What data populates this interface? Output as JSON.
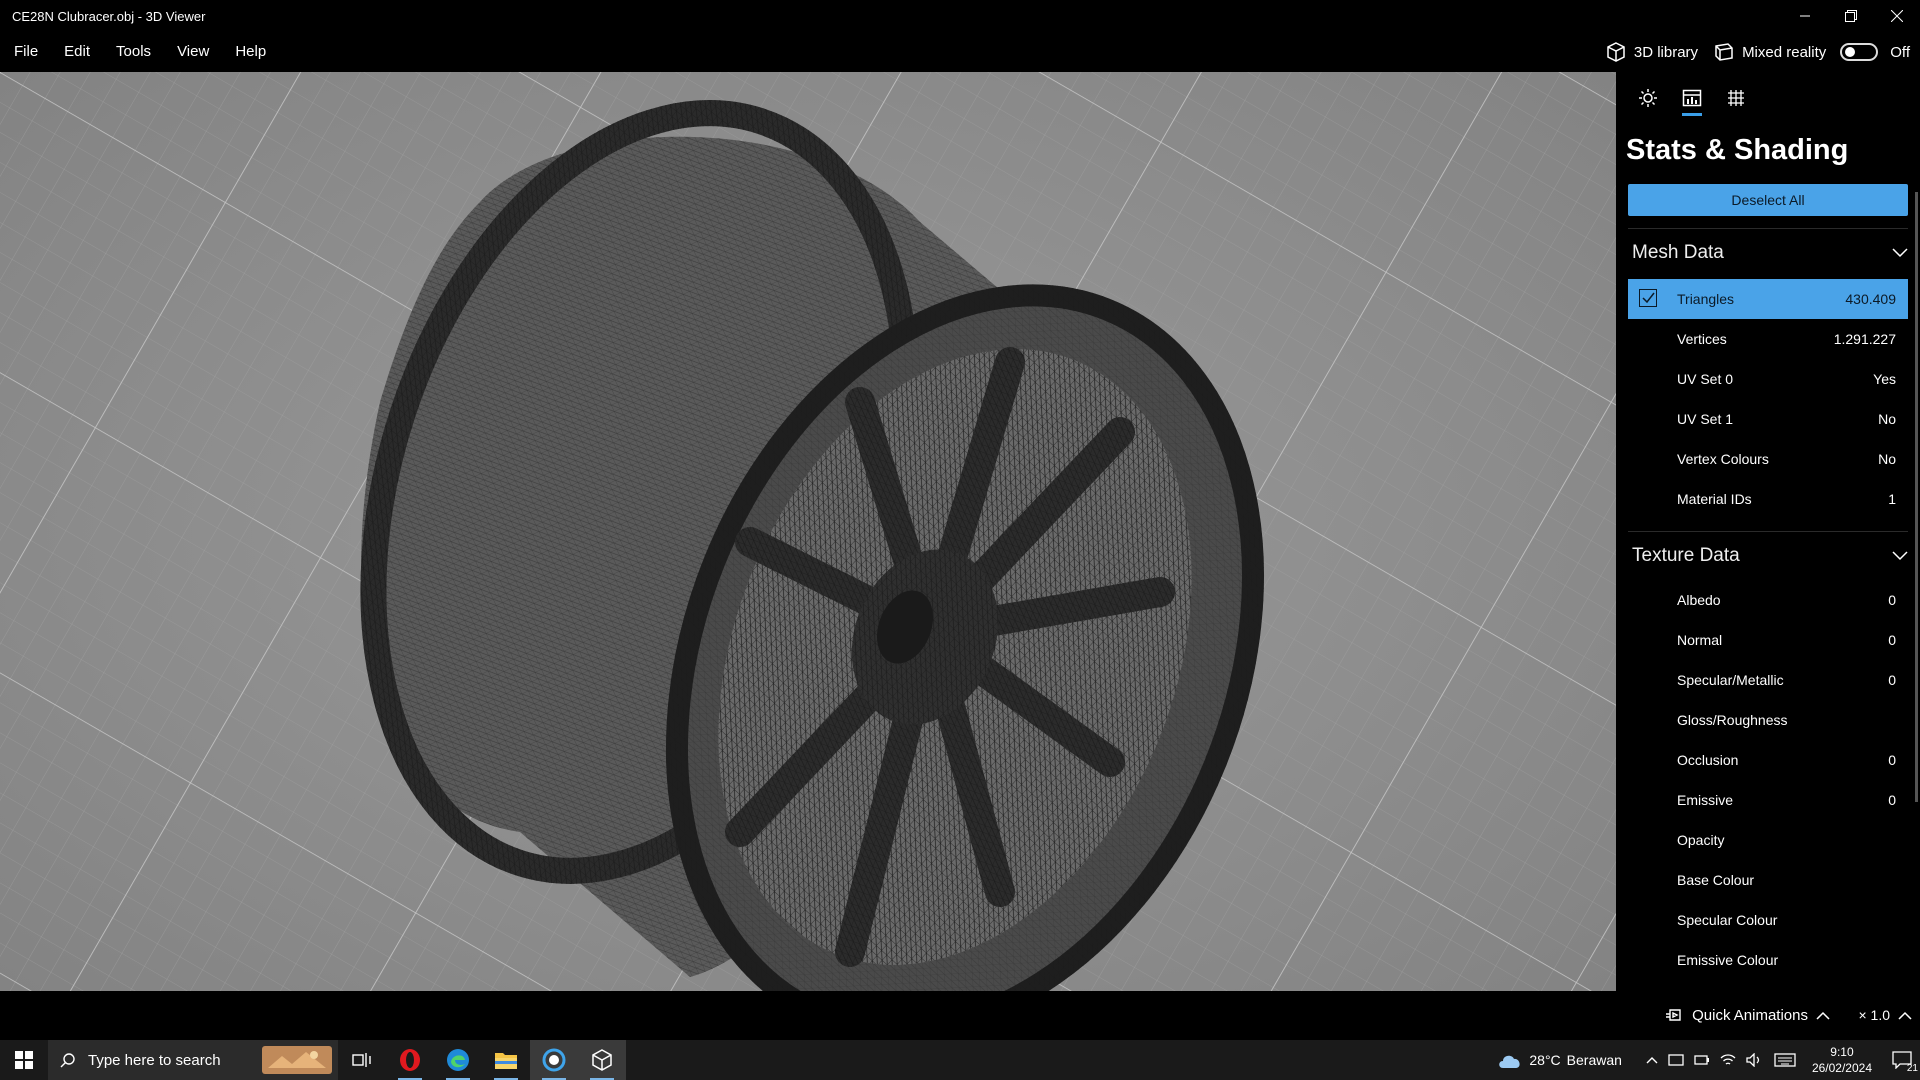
{
  "window": {
    "title": "CE28N Clubracer.obj - 3D Viewer",
    "controls": [
      "minimize-icon",
      "restore-icon",
      "close-icon"
    ]
  },
  "menu": {
    "items": [
      "File",
      "Edit",
      "Tools",
      "View",
      "Help"
    ],
    "library_label": "3D library",
    "mixed_reality_label": "Mixed reality",
    "mixed_reality_state": "Off"
  },
  "panel": {
    "tabs": [
      "lighting-icon",
      "stats-icon",
      "grid-icon"
    ],
    "active_tab": "stats-icon",
    "title": "Stats & Shading",
    "deselect_label": "Deselect All",
    "mesh_header": "Mesh Data",
    "mesh_rows": [
      {
        "label": "Triangles",
        "value": "430.409",
        "selected": true
      },
      {
        "label": "Vertices",
        "value": "1.291.227"
      },
      {
        "label": "UV Set 0",
        "value": "Yes"
      },
      {
        "label": "UV Set 1",
        "value": "No"
      },
      {
        "label": "Vertex Colours",
        "value": "No"
      },
      {
        "label": "Material IDs",
        "value": "1"
      }
    ],
    "texture_header": "Texture Data",
    "texture_rows": [
      {
        "label": "Albedo",
        "value": "0"
      },
      {
        "label": "Normal",
        "value": "0"
      },
      {
        "label": "Specular/Metallic",
        "value": "0"
      },
      {
        "label": "Gloss/Roughness",
        "value": ""
      },
      {
        "label": "Occlusion",
        "value": "0"
      },
      {
        "label": "Emissive",
        "value": "0"
      },
      {
        "label": "Opacity",
        "value": ""
      },
      {
        "label": "Base Colour",
        "value": ""
      },
      {
        "label": "Specular Colour",
        "value": ""
      },
      {
        "label": "Emissive Colour",
        "value": ""
      }
    ]
  },
  "status": {
    "quick_animations": "Quick Animations",
    "zoom": "× 1.0"
  },
  "taskbar": {
    "search_placeholder": "Type here to search",
    "weather_temp": "28°C",
    "weather_text": "Berawan",
    "time": "9:10",
    "date": "26/02/2024",
    "notification_count": "21"
  },
  "colors": {
    "accent": "#4aa3e8",
    "viewport_bg": "#8e8e8e"
  }
}
